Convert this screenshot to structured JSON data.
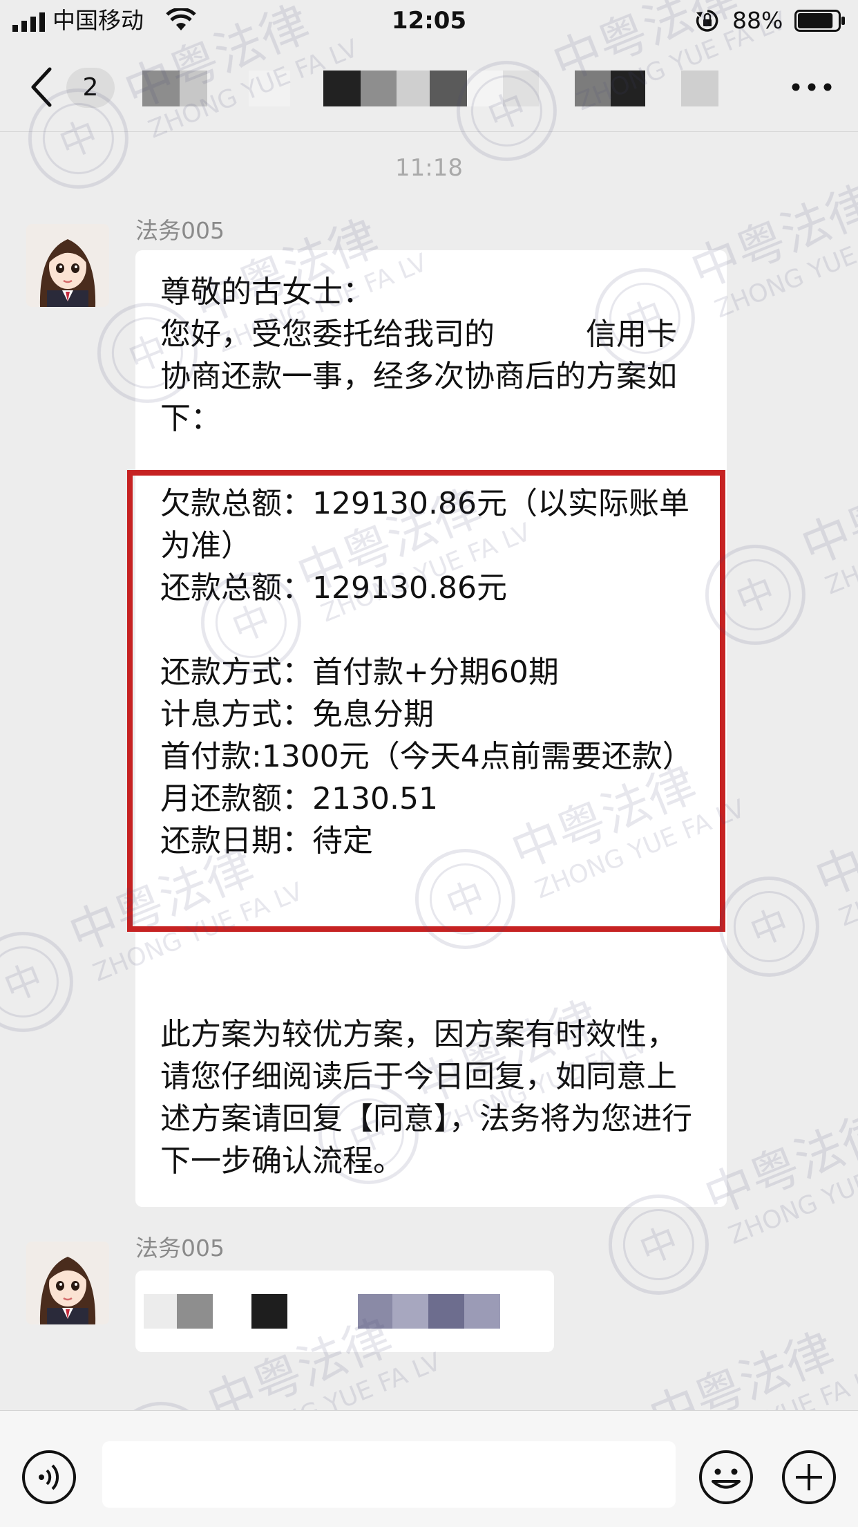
{
  "status_bar": {
    "carrier": "中国移动",
    "time": "12:05",
    "battery_percent": "88%",
    "battery_level": 0.88,
    "icons": [
      "signal-icon",
      "wifi-icon",
      "rotation-lock-icon",
      "battery-icon"
    ]
  },
  "nav": {
    "back_icon": "chevron-left-icon",
    "unread_count": "2",
    "more_icon": "more-dots-icon"
  },
  "chat": {
    "timestamp": "11:18",
    "messages": [
      {
        "sender": "法务005",
        "greeting": "尊敬的古女士：\n您好，受您委托给我司的　　　信用卡协商还款一事，经多次协商后的方案如下：",
        "plan": "欠款总额：129130.86元（以实际账单为准）\n还款总额：129130.86元\n\n还款方式：首付款+分期60期\n计息方式：免息分期\n首付款:1300元（今天4点前需要还款）\n月还款额：2130.51\n还款日期：待定",
        "closing": "此方案为较优方案，因方案有时效性，请您仔细阅读后于今日回复，如同意上述方案请回复【同意】，法务将为您进行下一步确认流程。",
        "highlight_color": "#c62222"
      },
      {
        "sender": "法务005"
      }
    ]
  },
  "watermark": {
    "cn": "中粤法律",
    "en": "ZHONG YUE FA LV",
    "seal_char": "中"
  },
  "input_bar": {
    "voice_icon": "voice-icon",
    "emoji_icon": "emoji-icon",
    "plus_icon": "plus-icon",
    "placeholder": ""
  }
}
